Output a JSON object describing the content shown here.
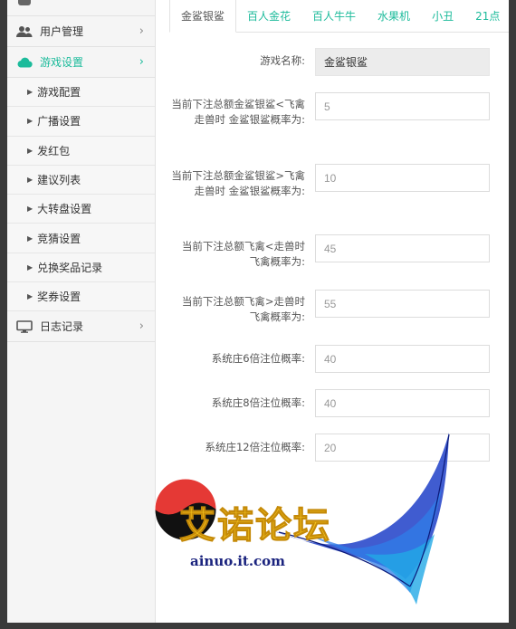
{
  "sidebar": {
    "groups": [
      {
        "label": "用户管理",
        "icon": "users-icon"
      },
      {
        "label": "游戏设置",
        "icon": "cloud-icon"
      },
      {
        "label": "日志记录",
        "icon": "monitor-icon"
      }
    ],
    "sub_items": [
      "游戏配置",
      "广播设置",
      "发红包",
      "建议列表",
      "大转盘设置",
      "竞猜设置",
      "兑换奖品记录",
      "奖券设置"
    ],
    "accent": "#1cbb9b"
  },
  "tabs": [
    "金鲨银鲨",
    "百人金花",
    "百人牛牛",
    "水果机",
    "小丑",
    "21点"
  ],
  "form": {
    "game_name_label": "游戏名称:",
    "game_name_value": "金鲨银鲨",
    "fields": [
      {
        "label": "当前下注总额金鲨银鲨<飞禽走兽时 金鲨银鲨概率为:",
        "value": "5"
      },
      {
        "label": "当前下注总额金鲨银鲨>飞禽走兽时 金鲨银鲨概率为:",
        "value": "10"
      },
      {
        "label": "当前下注总额飞禽<走兽时 飞禽概率为:",
        "value": "45"
      },
      {
        "label": "当前下注总额飞禽>走兽时 飞禽概率为:",
        "value": "55"
      },
      {
        "label": "系统庄6倍注位概率:",
        "value": "40"
      },
      {
        "label": "系统庄8倍注位概率:",
        "value": "40"
      },
      {
        "label": "系统庄12倍注位概率:",
        "value": "20"
      }
    ]
  },
  "watermark": {
    "text": "艾诺论坛",
    "url": "ainuo.it.com"
  }
}
